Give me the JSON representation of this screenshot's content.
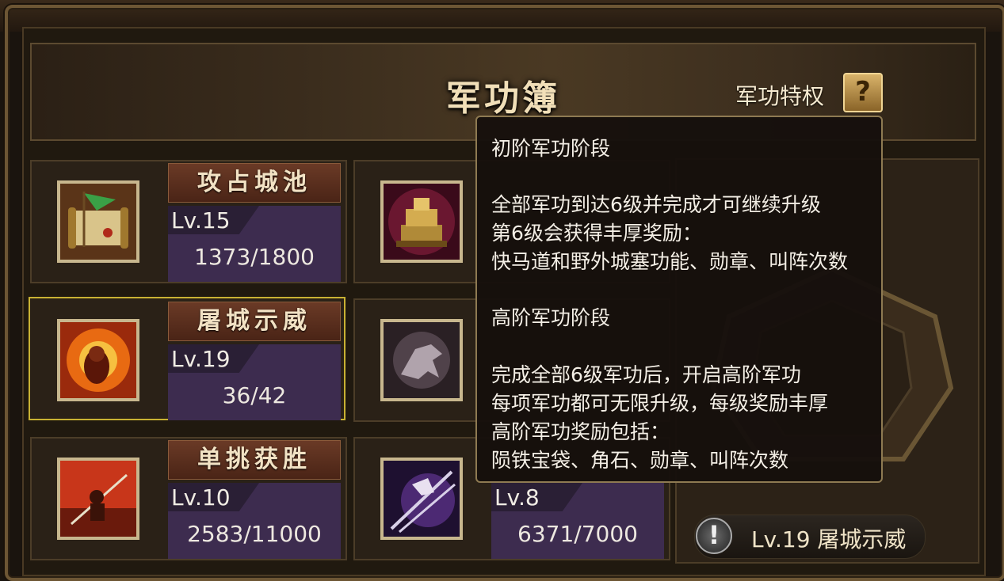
{
  "header": {
    "title": "军功簿",
    "privilege_label": "军功特权",
    "help_label": "?"
  },
  "cards": [
    {
      "name": "攻占城池",
      "level": "Lv.15",
      "progress": "1373/1800",
      "icon": "war-banner-scroll-icon"
    },
    {
      "name": "屠城示威",
      "level": "Lv.19",
      "progress": "36/42",
      "icon": "burning-warrior-icon"
    },
    {
      "name": "单挑获胜",
      "level": "Lv.10",
      "progress": "2583/11000",
      "icon": "duel-warrior-icon"
    }
  ],
  "cards_right": [
    {
      "icon": "golden-seal-icon"
    },
    {
      "icon": "phantom-horse-icon"
    },
    {
      "level": "Lv.8",
      "progress": "6371/7000",
      "icon": "spear-strike-icon"
    }
  ],
  "tooltip": {
    "lines": [
      "初阶军功阶段",
      "全部军功到达6级并完成才可继续升级",
      "第6级会获得丰厚奖励：",
      "快马道和野外城塞功能、勋章、叫阵次数",
      "高阶军功阶段",
      "完成全部6级军功后，开启高阶军功",
      "每项军功都可无限升级，每级奖励丰厚",
      "高阶军功奖励包括：",
      "陨铁宝袋、角石、勋章、叫阵次数"
    ]
  },
  "bottom": {
    "warn_glyph": "!",
    "text": "Lv.19 屠城示威"
  },
  "colors": {
    "selected_border": "#c9b233",
    "level_box": "#3d2c4f",
    "nameplate": "#6a3a26"
  }
}
